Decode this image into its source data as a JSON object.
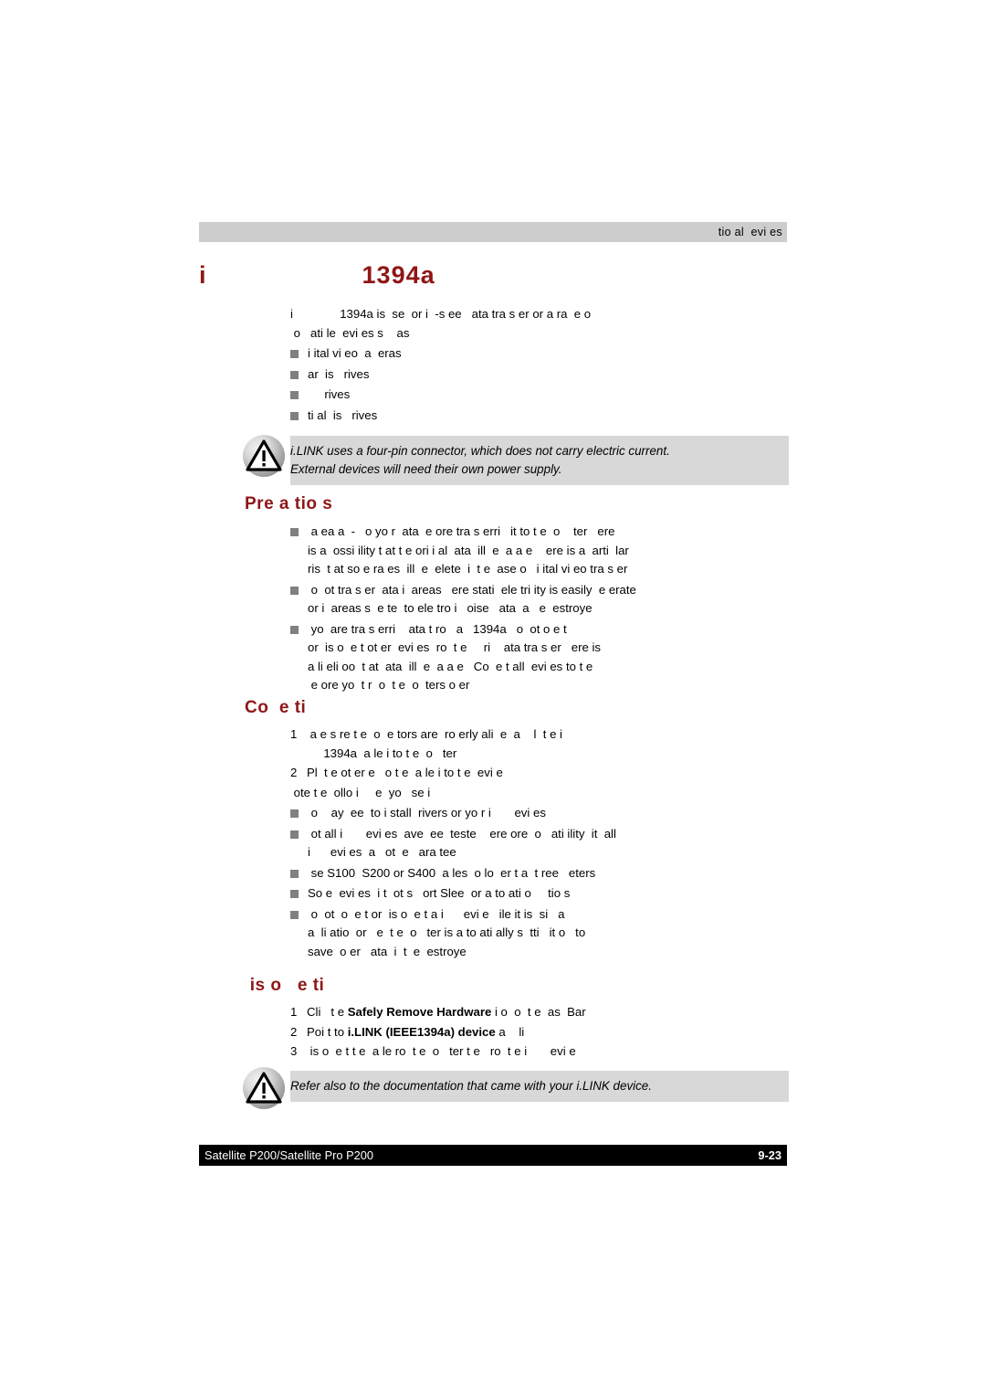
{
  "header": {
    "running_head": "tio al  evi es"
  },
  "title": {
    "text": "i                    1394a"
  },
  "intro": {
    "paragraph": "i              1394a is  se  or i  -s ee   ata tra s er or a ra  e o\n o   ati le  evi es s    as",
    "bullets": [
      "i ital vi eo  a  eras",
      "ar  is   rives",
      "     rives",
      "ti al  is   rives"
    ]
  },
  "note_top": {
    "icon": "warning-triangle-icon",
    "text": "i.LINK uses a four-pin connector, which does not carry electric current.\nExternal devices will need their own power supply."
  },
  "precautions": {
    "heading": "Pre a tio s",
    "bullets": [
      " a ea a  -   o yo r  ata  e ore tra s erri   it to t e  o    ter   ere\nis a  ossi ility t at t e ori i al  ata  ill  e  a a e    ere is a  arti  lar\nris  t at so e ra es  ill  e  elete  i  t e  ase o   i ital vi eo tra s er",
      " o  ot tra s er  ata i  areas   ere stati  ele tri ity is easily  e erate\nor i  areas s  e te  to ele tro i   oise   ata  a   e  estroye",
      " yo  are tra s erri    ata t ro   a   1394a   o  ot o e t\nor  is o  e t ot er  evi es  ro  t e     ri    ata tra s er   ere is\na li eli oo  t at  ata  ill  e  a a e   Co  e t all  evi es to t e\n e ore yo  t r  o  t e  o  ters o er"
    ]
  },
  "connecting": {
    "heading": "Co  e ti",
    "steps": [
      {
        "num": "1",
        "text": " a e s re t e  o  e tors are  ro erly ali  e  a    l  t e i\n     1394a  a le i to t e  o   ter"
      },
      {
        "num": "2",
        "text": "Pl  t e ot er e   o t e  a le i to t e  evi e"
      }
    ],
    "after_steps_note": " ote t e  ollo i     e  yo   se i",
    "bullets": [
      " o    ay  ee  to i stall  rivers or yo r i       evi es",
      " ot all i       evi es  ave  ee  teste    ere ore  o   ati ility  it  all\ni      evi es  a   ot  e   ara tee",
      " se S100  S200 or S400  a les  o lo  er t a  t ree   eters",
      "So e  evi es  i t  ot s   ort Slee  or a to ati o     tio s",
      " o  ot  o  e t or  is o  e t a i      evi e   ile it is  si   a\na  li atio  or   e  t e  o   ter is a to ati ally s  tti   it o   to\nsave  o er   ata  i  t  e  estroye"
    ]
  },
  "disconnecting": {
    "heading": " is o   e ti",
    "steps": [
      {
        "num": "1",
        "pre": "Cli   t e ",
        "bold": "Safely Remove Hardware",
        "post": " i o  o  t e  as  Bar"
      },
      {
        "num": "2",
        "pre": "Poi t to ",
        "bold": "i.LINK (IEEE1394a) device",
        "post": " a    li"
      },
      {
        "num": "3",
        "pre": " is o  e t t e  a le ro  t e  o   ter t e   ro  t e i       evi e",
        "bold": "",
        "post": ""
      }
    ]
  },
  "note_bottom": {
    "icon": "warning-triangle-icon",
    "text": "Refer also to the documentation that came with your i.LINK device."
  },
  "footer": {
    "left": "Satellite P200/Satellite Pro P200",
    "right": "9-23"
  },
  "colors": {
    "heading_red": "#8f1616",
    "header_bar_gray": "#cdcdcd",
    "note_bg_gray": "#d8d8d8",
    "bullet_gray": "#808080",
    "footer_black": "#000000"
  }
}
